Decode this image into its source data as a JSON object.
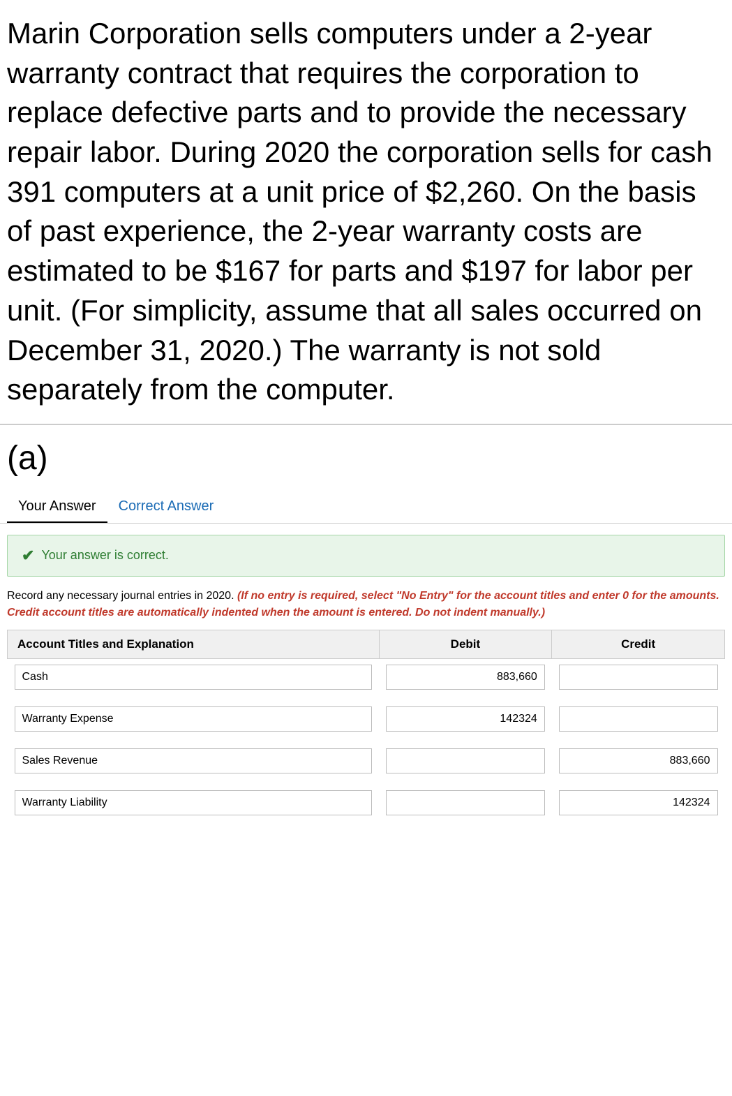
{
  "problem": {
    "text": "Marin Corporation sells computers under a 2-year warranty contract that requires the corporation to replace defective parts and to provide the necessary repair labor. During 2020 the corporation sells for cash 391 computers at a unit price of $2,260. On the basis of past experience, the 2-year warranty costs are estimated to be $167 for parts and $197 for labor per unit. (For simplicity, assume that all sales occurred on December 31, 2020.) The warranty is not sold separately from the computer."
  },
  "section": "(a)",
  "tabs": [
    {
      "label": "Your Answer",
      "active": true
    },
    {
      "label": "Correct Answer",
      "active": false
    }
  ],
  "correct_banner": "Your answer is correct.",
  "instructions_plain": "Record any necessary journal entries in 2020. ",
  "instructions_bold": "(If no entry is required, select \"No Entry\" for the account titles and enter 0 for the amounts. Credit account titles are automatically indented when the amount is entered. Do not indent manually.)",
  "table": {
    "headers": {
      "account": "Account Titles and Explanation",
      "debit": "Debit",
      "credit": "Credit"
    },
    "rows": [
      {
        "account": "Cash",
        "debit": "883,660",
        "credit": ""
      },
      {
        "account": "Warranty Expense",
        "debit": "142324",
        "credit": ""
      },
      {
        "account": "Sales Revenue",
        "debit": "",
        "credit": "883,660"
      },
      {
        "account": "Warranty Liability",
        "debit": "",
        "credit": "142324"
      }
    ]
  }
}
